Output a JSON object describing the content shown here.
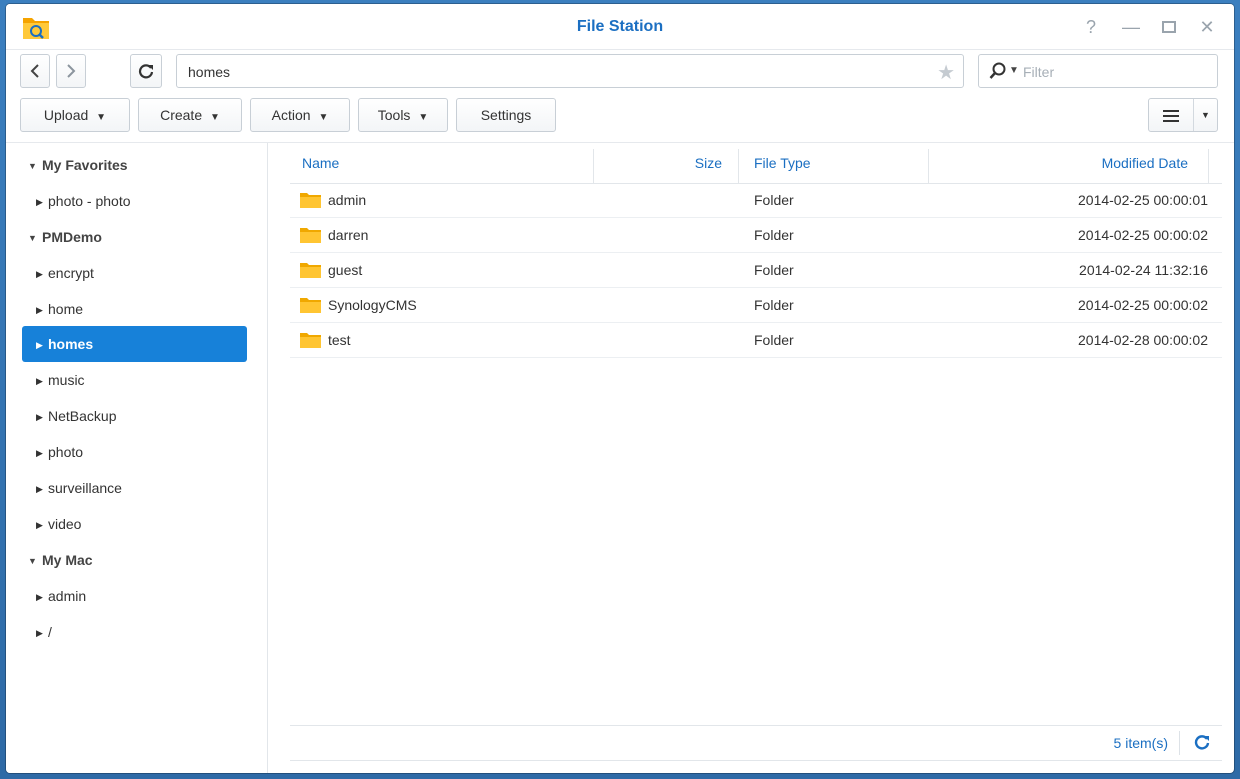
{
  "window": {
    "title": "File Station"
  },
  "navigation": {
    "back_icon": "chevron-left-icon",
    "forward_icon": "chevron-right-icon",
    "refresh_icon": "refresh-icon",
    "path": "homes",
    "favorite_icon": "star-icon",
    "filter_placeholder": "Filter"
  },
  "toolbar": {
    "upload": "Upload",
    "create": "Create",
    "action": "Action",
    "tools": "Tools",
    "settings": "Settings",
    "caret": "▾"
  },
  "sidebar": {
    "groups": [
      {
        "label": "My Favorites",
        "items": [
          "photo - photo"
        ]
      },
      {
        "label": "PMDemo",
        "items": [
          "encrypt",
          "home",
          "homes",
          "music",
          "NetBackup",
          "photo",
          "surveillance",
          "video"
        ]
      },
      {
        "label": "My Mac",
        "items": [
          "admin",
          "/"
        ]
      }
    ],
    "selected": "homes"
  },
  "table": {
    "columns": [
      "Name",
      "Size",
      "File Type",
      "Modified Date"
    ],
    "rows": [
      {
        "name": "admin",
        "size": "",
        "type": "Folder",
        "modified": "2014-02-25 00:00:01"
      },
      {
        "name": "darren",
        "size": "",
        "type": "Folder",
        "modified": "2014-02-25 00:00:02"
      },
      {
        "name": "guest",
        "size": "",
        "type": "Folder",
        "modified": "2014-02-24 11:32:16"
      },
      {
        "name": "SynologyCMS",
        "size": "",
        "type": "Folder",
        "modified": "2014-02-25 00:00:02"
      },
      {
        "name": "test",
        "size": "",
        "type": "Folder",
        "modified": "2014-02-28 00:00:02"
      }
    ]
  },
  "status": {
    "item_count": "5 item(s)"
  },
  "colors": {
    "accent": "#1b6fc2",
    "selection": "#1781d9",
    "folder": "#f5b400"
  }
}
